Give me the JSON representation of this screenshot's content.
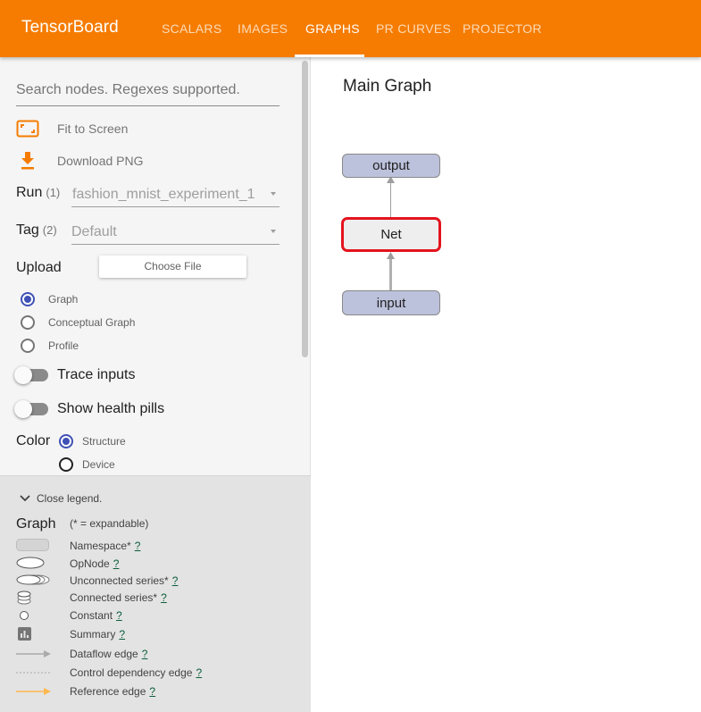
{
  "header": {
    "brand": "TensorBoard",
    "tabs": [
      {
        "label": "SCALARS"
      },
      {
        "label": "IMAGES"
      },
      {
        "label": "GRAPHS"
      },
      {
        "label": "PR CURVES"
      },
      {
        "label": "PROJECTOR"
      }
    ],
    "active_tab": "GRAPHS",
    "accent_color": "#f57c00"
  },
  "sidebar": {
    "search_placeholder": "Search nodes. Regexes supported.",
    "fit_to_screen": "Fit to Screen",
    "download_png": "Download PNG",
    "run": {
      "label": "Run",
      "count": "(1)",
      "value": "fashion_mnist_experiment_1"
    },
    "tag": {
      "label": "Tag",
      "count": "(2)",
      "value": "Default"
    },
    "upload": {
      "label": "Upload",
      "button": "Choose File"
    },
    "graph_types": [
      {
        "label": "Graph",
        "selected": true
      },
      {
        "label": "Conceptual Graph",
        "selected": false
      },
      {
        "label": "Profile",
        "selected": false
      }
    ],
    "trace_inputs": "Trace inputs",
    "health_pills": "Show health pills",
    "color": {
      "label": "Color",
      "options": [
        {
          "label": "Structure",
          "selected": true
        },
        {
          "label": "Device",
          "selected": false
        }
      ]
    }
  },
  "legend": {
    "close": "Close legend.",
    "title": "Graph",
    "expandable_note": "(* = expandable)",
    "items": [
      {
        "label": "Namespace*",
        "icon": "namespace-icon"
      },
      {
        "label": "OpNode",
        "icon": "opnode-icon"
      },
      {
        "label": "Unconnected series*",
        "icon": "unconnected-series-icon"
      },
      {
        "label": "Connected series*",
        "icon": "connected-series-icon"
      },
      {
        "label": "Constant",
        "icon": "constant-icon"
      },
      {
        "label": "Summary",
        "icon": "summary-icon"
      },
      {
        "label": "Dataflow edge",
        "icon": "dataflow-edge-icon"
      },
      {
        "label": "Control dependency edge",
        "icon": "control-edge-icon"
      },
      {
        "label": "Reference edge",
        "icon": "reference-edge-icon"
      }
    ],
    "help": "?"
  },
  "graph": {
    "title": "Main Graph",
    "nodes": [
      {
        "label": "output"
      },
      {
        "label": "Net"
      },
      {
        "label": "input"
      }
    ]
  }
}
